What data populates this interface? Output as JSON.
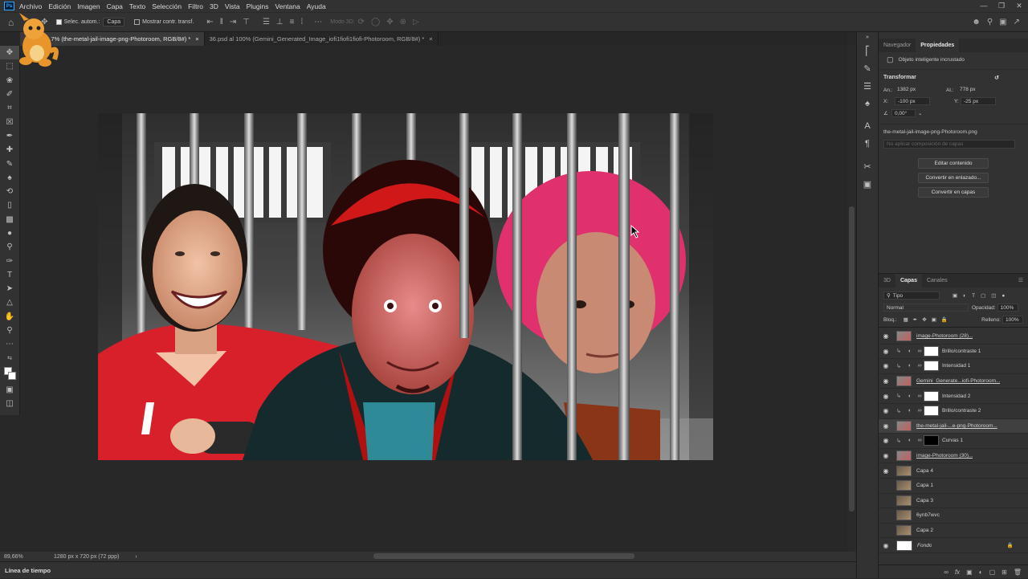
{
  "menu": {
    "items": [
      "Archivo",
      "Edición",
      "Imagen",
      "Capa",
      "Texto",
      "Selección",
      "Filtro",
      "3D",
      "Vista",
      "Plugins",
      "Ventana",
      "Ayuda"
    ],
    "logo": "Ps"
  },
  "options": {
    "auto_select": "Selec. autom.:",
    "target": "Capa",
    "show_transform": "Mostrar contr. transf.",
    "mode3d": "Modo 3D:"
  },
  "tabs": [
    {
      "label": "89,7% (the-metal-jail-image-png-Photoroom, RGB/8#) *"
    },
    {
      "label": "36.psd al 100% (Gemini_Generated_Image_iofi1fiofi1fiofi-Photoroom, RGB/8#) *"
    }
  ],
  "status": {
    "zoom": "89,66%",
    "doc": "1280 px x 720 px (72 ppp)"
  },
  "timeline": "Línea de tiempo",
  "panel_top": {
    "tab_nav": "Navegador",
    "tab_props": "Propiedades",
    "object_type": "Objeto inteligente incrustado",
    "transform_title": "Transformar",
    "an_label": "An.:",
    "an_value": "1382 px",
    "al_label": "Al.:",
    "al_value": "778 px",
    "x_label": "X:",
    "x_value": "-100 px",
    "y_label": "Y:",
    "y_value": "-25 px",
    "angle": "0,00°",
    "filename": "the-metal-jail-image-png-Photoroom.png",
    "comp_placeholder": "No aplicar composición de capas",
    "btn_edit": "Editar contenido",
    "btn_linked": "Convertir en enlazado...",
    "btn_layers": "Convertir en capas"
  },
  "layers_panel": {
    "tab_3d": "3D",
    "tab_layers": "Capas",
    "tab_channels": "Canales",
    "filter_kind": "Tipo",
    "blend_mode": "Normal",
    "opacity_label": "Opacidad:",
    "opacity_value": "100%",
    "lock_label": "Bloq.:",
    "fill_label": "Relleno:",
    "fill_value": "100%",
    "layers": [
      {
        "name": "image-Photoroom (28)...",
        "visible": true,
        "type": "smart"
      },
      {
        "name": "Brillo/contraste 1",
        "visible": true,
        "type": "adj"
      },
      {
        "name": "Intensidad 1",
        "visible": true,
        "type": "adj"
      },
      {
        "name": "Gemini_Generate...iofi-Photoroom...",
        "visible": true,
        "type": "smart"
      },
      {
        "name": "Intensidad 2",
        "visible": true,
        "type": "adj"
      },
      {
        "name": "Brillo/contraste 2",
        "visible": true,
        "type": "adj"
      },
      {
        "name": "the-metal-jail-...e-png-Photoroom...",
        "visible": true,
        "type": "smart",
        "selected": true
      },
      {
        "name": "Curvas 1",
        "visible": true,
        "type": "adjdark"
      },
      {
        "name": "image-Photoroom (30)...",
        "visible": true,
        "type": "smart"
      },
      {
        "name": "Capa 4",
        "visible": true,
        "type": "pixel"
      },
      {
        "name": "Capa 1",
        "visible": false,
        "type": "pixel"
      },
      {
        "name": "Capa 3",
        "visible": false,
        "type": "pixel"
      },
      {
        "name": "6ynb7wvc",
        "visible": false,
        "type": "pixel"
      },
      {
        "name": "Capa 2",
        "visible": false,
        "type": "pixel"
      },
      {
        "name": "Fondo",
        "visible": true,
        "type": "bg"
      }
    ]
  }
}
